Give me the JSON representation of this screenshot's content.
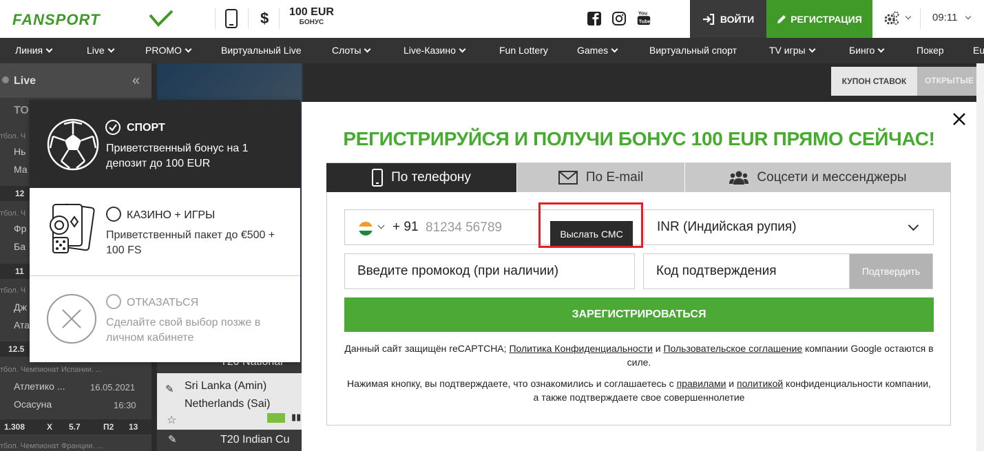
{
  "header": {
    "bonus_amount": "100 EUR",
    "bonus_label": "БОНУС",
    "dollar_symbol": "$",
    "login_label": "ВОЙТИ",
    "register_label": "РЕГИСТРАЦИЯ",
    "time": "09:11"
  },
  "nav": {
    "items": [
      {
        "label": "Линия"
      },
      {
        "label": "Live"
      },
      {
        "label": "PROMO"
      },
      {
        "label": "Виртуальный Live"
      },
      {
        "label": "Слоты"
      },
      {
        "label": "Live-Казино"
      },
      {
        "label": "Fun Lottery"
      },
      {
        "label": "Games"
      },
      {
        "label": "Виртуальный спорт"
      },
      {
        "label": "TV игры"
      },
      {
        "label": "Бинго"
      },
      {
        "label": "Покер"
      },
      {
        "label": "Eu"
      }
    ]
  },
  "sidebar": {
    "live_label": "Live",
    "top_partial": "ТО",
    "rows": [
      {
        "text": "тбол. Ч"
      },
      {
        "text": "Нь"
      },
      {
        "text": "Ма"
      },
      {
        "text": "12"
      },
      {
        "text": "тбол. Ч"
      },
      {
        "text": "Фр"
      },
      {
        "text": "Ба"
      },
      {
        "text": "11"
      },
      {
        "text": "тбол. Ч"
      },
      {
        "text": "Дж"
      },
      {
        "text": "Ата"
      },
      {
        "text": "12.5"
      }
    ],
    "league": "тбол. Чемпионат Испании. ...",
    "team1": "Атлетико ...",
    "team2": "Осасуна",
    "date": "16.05.2021",
    "time": "16:30",
    "odds": {
      "o1": "1.308",
      "ox": "X",
      "o2": "5.7",
      "p2": "П2",
      "v": "13"
    },
    "league2": "тбол. Чемпионат Франции. ..."
  },
  "center": {
    "match1": "T20 National",
    "match2_team1": "Sri Lanka (Amin)",
    "match2_team2": "Netherlands (Sai)",
    "match3": "T20 Indian Cu"
  },
  "coupon": {
    "tab1": "КУПОН СТАВОК",
    "tab2": "ОТКРЫТЫЕ С"
  },
  "bonus_choice": {
    "sport": {
      "title": "СПОРТ",
      "desc": "Приветственный бонус на 1 депозит до 100 EUR"
    },
    "casino": {
      "title": "КАЗИНО + ИГРЫ",
      "desc": "Приветственный пакет до €500 + 100 FS"
    },
    "decline": {
      "title": "ОТКАЗАТЬСЯ",
      "desc": "Сделайте свой выбор позже в личном кабинете"
    }
  },
  "modal": {
    "title": "РЕГИСТРИРУЙСЯ И ПОЛУЧИ БОНУС 100 EUR ПРЯМО СЕЙЧАС!",
    "tabs": {
      "phone": "По телефону",
      "email": "По E-mail",
      "social": "Соцсети и мессенджеры"
    },
    "phone_prefix": "+ 91",
    "phone_placeholder": "81234 56789",
    "sms_button": "Выслать СМС",
    "currency": "INR (Индийская рупия)",
    "promo_placeholder": "Введите промокод (при наличии)",
    "code_placeholder": "Код подтверждения",
    "confirm_button": "Подтвердить",
    "register_button": "ЗАРЕГИСТРИРОВАТЬСЯ",
    "legal1": {
      "pre": "Данный сайт защищён reCAPTCHA; ",
      "link1": "Политика Конфиденциальности",
      "mid": " и ",
      "link2": "Пользовательское соглашение",
      "post": " компании Google остаются в силе."
    },
    "legal2": {
      "pre": "Нажимая кнопку, вы подтверждаете, что ознакомились и соглашаетесь с ",
      "link1": "правилами",
      "mid": " и ",
      "link2": "политикой",
      "post": " конфиденциальности компании, а также подтверждаете свое совершеннолетие"
    }
  },
  "colors": {
    "brand_green": "#46ab2e",
    "register_green": "#4da935",
    "highlight_red": "#e31e24",
    "dark": "#2b2b2b"
  },
  "icons": [
    "phone-icon",
    "facebook-icon",
    "instagram-icon",
    "youtube-icon",
    "login-icon",
    "pencil-icon",
    "gear-icon",
    "close-icon",
    "mobile-icon",
    "envelope-icon",
    "users-icon",
    "soccer-ball-icon",
    "casino-cards-icon",
    "decline-x-icon",
    "india-flag-icon"
  ]
}
